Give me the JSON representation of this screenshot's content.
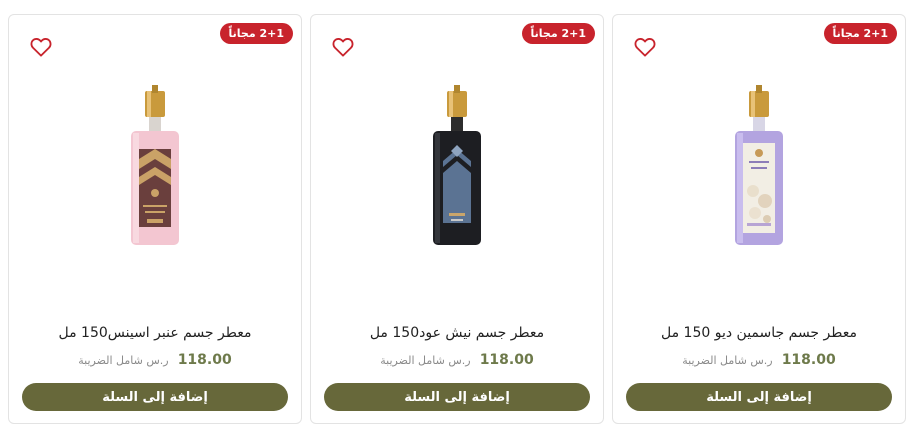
{
  "products": [
    {
      "badge": "2+1 مجاناً",
      "title": "معطر جسم عنبر اسينس150 مل",
      "price": "118.00",
      "price_note": "ر.س شامل الضريبة",
      "button_label": "إضافة إلى السلة"
    },
    {
      "badge": "2+1 مجاناً",
      "title": "معطر جسم نيش عود150 مل",
      "price": "118.00",
      "price_note": "ر.س شامل الضريبة",
      "button_label": "إضافة إلى السلة"
    },
    {
      "badge": "2+1 مجاناً",
      "title": "معطر جسم جاسمين ديو 150 مل",
      "price": "118.00",
      "price_note": "ر.س شامل الضريبة",
      "button_label": "إضافة إلى السلة"
    }
  ],
  "colors": {
    "badge": "#c8232c",
    "price": "#6e7a4b",
    "button": "#67683a",
    "heart": "#c8232c"
  },
  "icons": {
    "wishlist": "heart-outline-icon"
  }
}
